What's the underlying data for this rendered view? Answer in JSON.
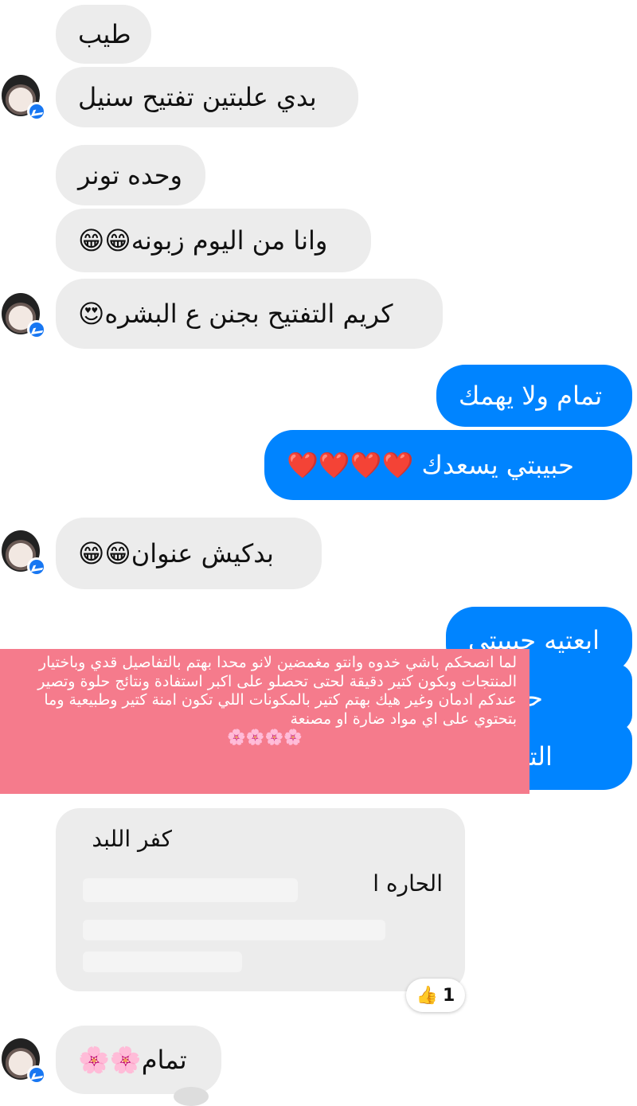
{
  "messages": [
    {
      "side": "in",
      "text": "طيب"
    },
    {
      "side": "in",
      "text": "بدي علبتين تفتيح سنيل"
    },
    {
      "side": "in",
      "text": "وحده تونر"
    },
    {
      "side": "in",
      "text": "وانا من اليوم زبونه😁😁"
    },
    {
      "side": "in",
      "text": "كريم التفتيح بجنن ع البشره😍"
    },
    {
      "side": "out",
      "text": "تمام ولا يهمك"
    },
    {
      "side": "out",
      "text": "حبيبتي يسعدك ❤️❤️❤️❤️"
    },
    {
      "side": "in",
      "text": "بدكيش عنوان😁😁"
    },
    {
      "side": "out",
      "text": "ابعتيه حبيبتي"
    },
    {
      "side": "out",
      "text": "حسابك"
    },
    {
      "side": "out",
      "text": "التوصيل"
    },
    {
      "side": "in",
      "text": "تمام🌸🌸"
    }
  ],
  "overlay": {
    "text": "لما انصحكم باشي خدوه وانتو مغمضين لانو محدا بهتم بالتفاصيل قدي وباختيار المنتجات وبكون كتير دقيقة لحتى تحصلو على اكبر استفادة ونتائج حلوة وتصير عندكم ادمان وغير هيك بهتم كتير بالمكونات اللي تكون امنة كتير وطبيعية وما بتحتوي على اي مواد ضارة او مصنعة",
    "flowers": "🌸🌸🌸🌸"
  },
  "address": {
    "line1": "كفر اللبد",
    "line2": "الحاره ا"
  },
  "reaction": {
    "emoji": "👍",
    "count": "1"
  },
  "colors": {
    "incoming": "#ececec",
    "outgoing": "#0084ff",
    "overlay": "#f57b8c",
    "badge": "#1877f2"
  }
}
